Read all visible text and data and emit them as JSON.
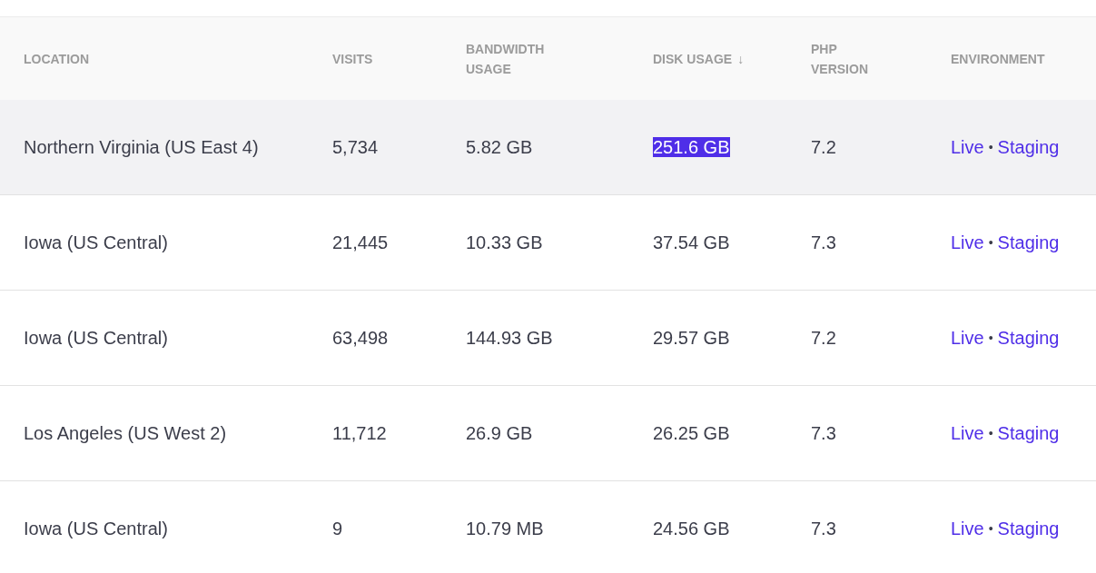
{
  "table": {
    "columns": [
      {
        "label": "LOCATION"
      },
      {
        "label": "VISITS"
      },
      {
        "label": "BANDWIDTH USAGE"
      },
      {
        "label": "DISK USAGE",
        "sort_indicator": "↓"
      },
      {
        "label": "PHP VERSION"
      },
      {
        "label": "ENVIRONMENT"
      }
    ],
    "rows": [
      {
        "hovered": true,
        "location": "Northern Virginia (US East 4)",
        "visits": "5,734",
        "bandwidth": "5.82 GB",
        "disk_usage": {
          "text": "251.6 GB",
          "highlighted": true
        },
        "php_version": "7.2",
        "environment": {
          "live": "Live",
          "separator": "•",
          "staging": "Staging"
        }
      },
      {
        "hovered": false,
        "location": "Iowa (US Central)",
        "visits": "21,445",
        "bandwidth": "10.33 GB",
        "disk_usage": {
          "text": "37.54 GB",
          "highlighted": false
        },
        "php_version": "7.3",
        "environment": {
          "live": "Live",
          "separator": "•",
          "staging": "Staging"
        }
      },
      {
        "hovered": false,
        "location": "Iowa (US Central)",
        "visits": "63,498",
        "bandwidth": "144.93 GB",
        "disk_usage": {
          "text": "29.57 GB",
          "highlighted": false
        },
        "php_version": "7.2",
        "environment": {
          "live": "Live",
          "separator": "•",
          "staging": "Staging"
        }
      },
      {
        "hovered": false,
        "location": "Los Angeles (US West 2)",
        "visits": "11,712",
        "bandwidth": "26.9 GB",
        "disk_usage": {
          "text": "26.25 GB",
          "highlighted": false
        },
        "php_version": "7.3",
        "environment": {
          "live": "Live",
          "separator": "•",
          "staging": "Staging"
        }
      },
      {
        "hovered": false,
        "location": "Iowa (US Central)",
        "visits": "9",
        "bandwidth": "10.79 MB",
        "disk_usage": {
          "text": "24.56 GB",
          "highlighted": false
        },
        "php_version": "7.3",
        "environment": {
          "live": "Live",
          "separator": "•",
          "staging": "Staging"
        }
      }
    ]
  }
}
